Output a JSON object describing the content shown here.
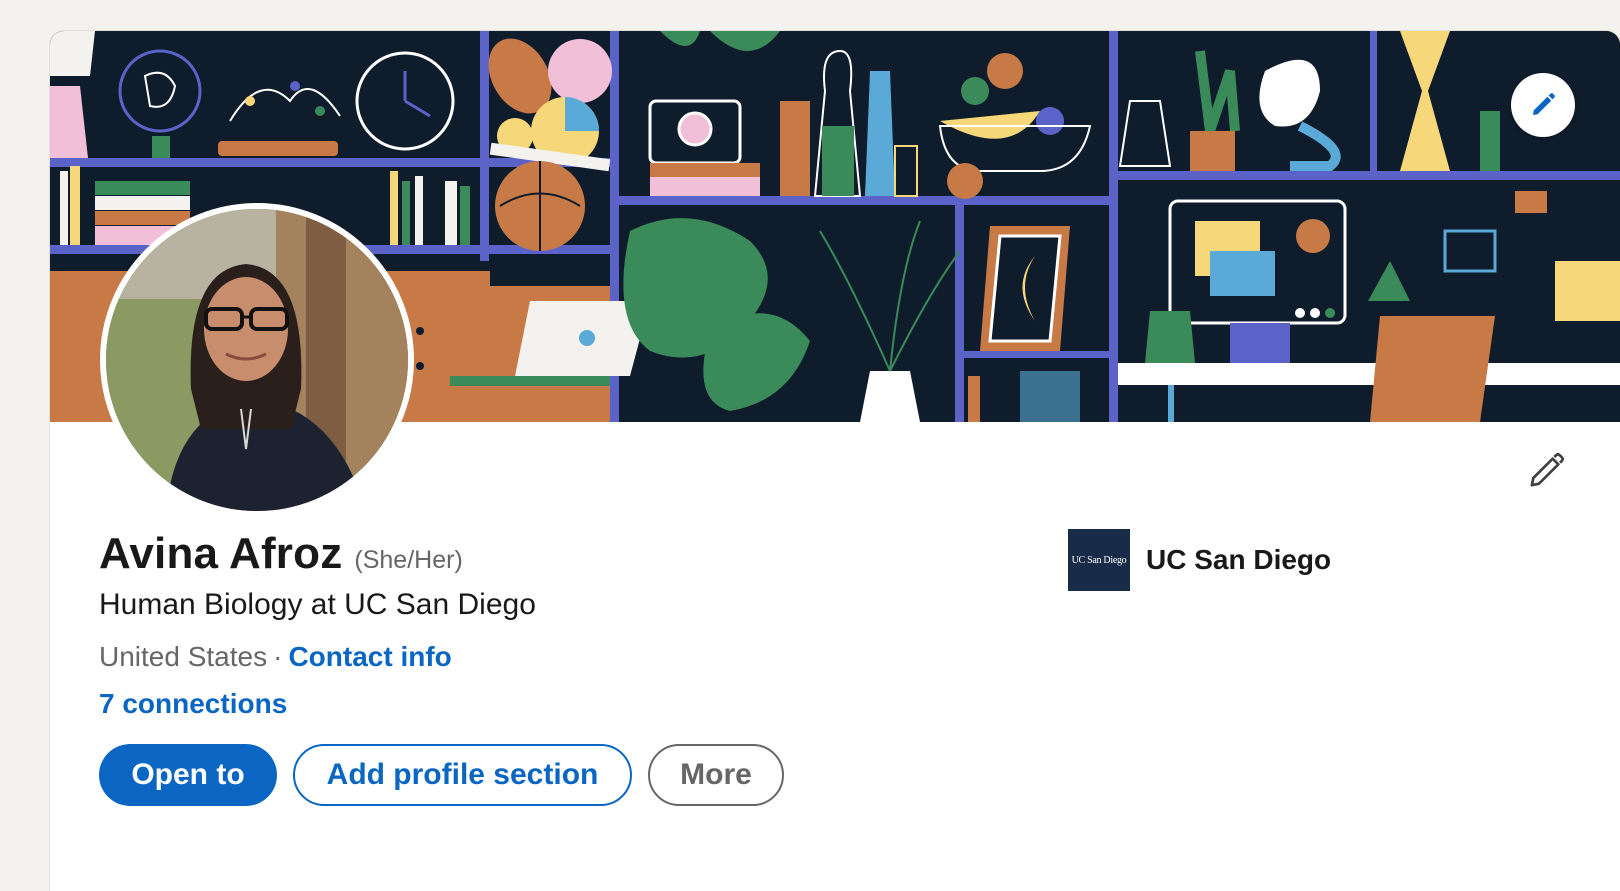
{
  "profile": {
    "name": "Avina Afroz",
    "pronouns": "(She/Her)",
    "headline": "Human Biology at UC San Diego",
    "location": "United States",
    "separator": "·",
    "contact_info_label": "Contact info",
    "connections_label": "7 connections"
  },
  "education": {
    "school_name": "UC San Diego",
    "logo_text": "UC San Diego"
  },
  "actions": {
    "open_to_label": "Open to",
    "add_section_label": "Add profile section",
    "more_label": "More"
  },
  "icons": {
    "banner_edit": "pencil-icon",
    "intro_edit": "pencil-icon"
  },
  "colors": {
    "accent": "#0a66c2",
    "text": "#191919",
    "muted": "#666666",
    "page_bg": "#f3f2ef",
    "school_logo_bg": "#182b49"
  }
}
